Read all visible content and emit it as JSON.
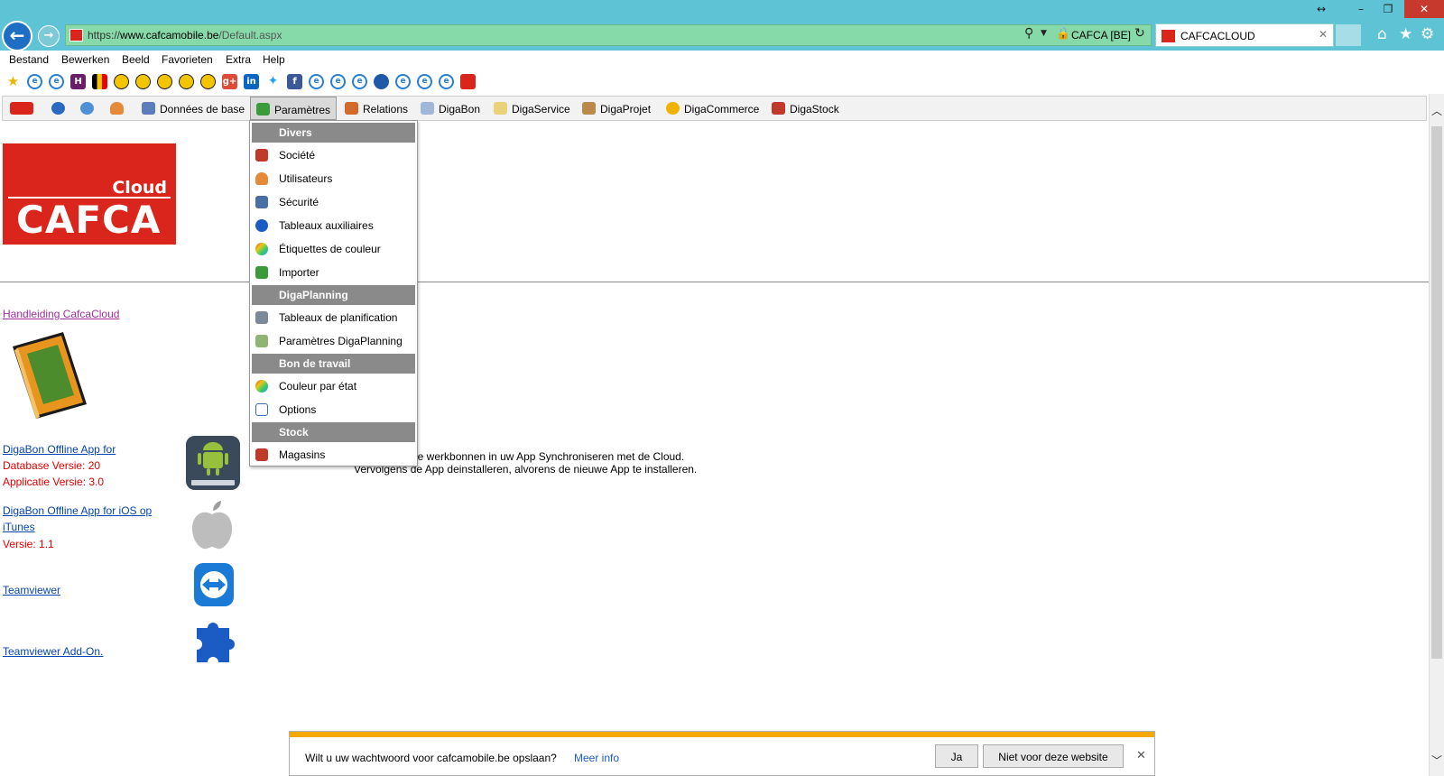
{
  "browser": {
    "url_scheme": "https://",
    "url_host": "www.cafcamobile.be",
    "url_path": "/Default.aspx",
    "certificate": "CAFCA [BE]",
    "tab_title": "CAFCACLOUD",
    "accent": "#5ec3d5",
    "address_bg": "#86d9a8"
  },
  "menubar": {
    "items": [
      "Bestand",
      "Bewerken",
      "Beeld",
      "Favorieten",
      "Extra",
      "Help"
    ]
  },
  "favorites": [
    "star-icon",
    "ie-icon",
    "ie-icon",
    "h-icon",
    "flag-be-icon",
    "ball-icon",
    "ball-icon",
    "ball-icon",
    "ball-icon",
    "gplus-icon",
    "linkedin-icon",
    "twitter-icon",
    "facebook-icon",
    "ie-icon",
    "ie-icon",
    "ie-icon",
    "globe-icon",
    "ie-icon",
    "ie-icon",
    "ie-icon",
    "cafca-icon"
  ],
  "app_menu": {
    "items": [
      {
        "label": "",
        "icon": "cafca-logo-icon"
      },
      {
        "label": "",
        "icon": "globe-icon"
      },
      {
        "label": "",
        "icon": "sync-icon"
      },
      {
        "label": "",
        "icon": "user-icon"
      },
      {
        "label": "Données de base",
        "icon": "database-icon"
      },
      {
        "label": "Paramètres",
        "icon": "settings-icon"
      },
      {
        "label": "Relations",
        "icon": "relations-icon"
      },
      {
        "label": "DigaBon",
        "icon": "document-icon"
      },
      {
        "label": "DigaService",
        "icon": "service-icon"
      },
      {
        "label": "DigaProjet",
        "icon": "project-icon"
      },
      {
        "label": "DigaCommerce",
        "icon": "commerce-icon"
      },
      {
        "label": "DigaStock",
        "icon": "stock-icon"
      }
    ]
  },
  "dropdown": {
    "sections": [
      {
        "title": "Divers",
        "items": [
          "Société",
          "Utilisateurs",
          "Sécurité",
          "Tableaux auxiliaires",
          "Étiquettes de couleur",
          "Importer"
        ]
      },
      {
        "title": "DigaPlanning",
        "items": [
          "Tableaux de planification",
          "Paramètres DigaPlanning"
        ]
      },
      {
        "title": "Bon de travail",
        "items": [
          "Couleur par état",
          "Options"
        ]
      },
      {
        "title": "Stock",
        "items": [
          "Magasins"
        ]
      }
    ]
  },
  "logo": {
    "line1": "Cloud",
    "line2": "CAFCA",
    "color": "#d9251c"
  },
  "links": {
    "manual": "Handleiding CafcaCloud",
    "android": "DigaBon Offline App for",
    "android_db": "Database Versie: 20",
    "android_app": "Applicatie Versie: 3.0",
    "ios_1": "DigaBon Offline App for iOS op",
    "ios_2": "iTunes",
    "ios_version": "Versie: 1.1",
    "teamviewer": "Teamviewer",
    "teamviewer_addon": "Teamviewer Add-On."
  },
  "notes": {
    "line1": "de werkbonnen in uw App Synchroniseren met de Cloud.",
    "line2": "Vervolgens de App deinstalleren, alvorens de nieuwe App te installeren."
  },
  "password_bar": {
    "question": "Wilt u uw wachtwoord voor cafcamobile.be opslaan?",
    "more": "Meer info",
    "yes": "Ja",
    "never": "Niet voor deze website",
    "accent": "#f5a800"
  }
}
